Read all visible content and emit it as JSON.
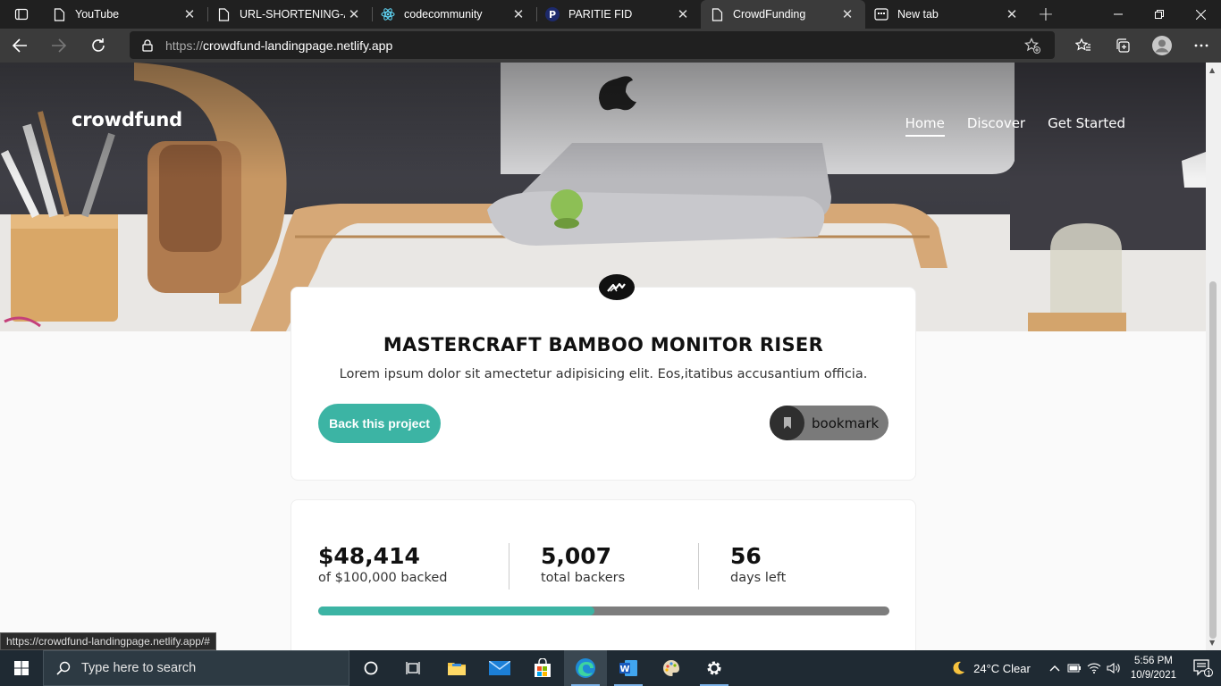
{
  "browser": {
    "tabs": [
      {
        "title": "YouTube",
        "icon": "page-icon",
        "active": false
      },
      {
        "title": "URL-SHORTENING-API",
        "icon": "page-icon",
        "active": false
      },
      {
        "title": "codecommunity",
        "icon": "react-icon",
        "active": false
      },
      {
        "title": "PARITIE FID",
        "icon": "p-logo-icon",
        "active": false
      },
      {
        "title": "CrowdFunding",
        "icon": "page-icon",
        "active": true
      },
      {
        "title": "New tab",
        "icon": "newtab-icon",
        "active": false
      }
    ],
    "close_glyph": "✕",
    "new_tab_glyph": "+",
    "url_scheme": "https://",
    "url_host": "crowdfund-landingpage.netlify.app",
    "status_url": "https://crowdfund-landingpage.netlify.app/#"
  },
  "site": {
    "brand": "crowdfund",
    "nav": [
      "Home",
      "Discover",
      "Get Started"
    ],
    "active_nav": "Home"
  },
  "project": {
    "title": "MASTERCRAFT BAMBOO MONITOR RISER",
    "description": "Lorem ipsum dolor sit amectetur adipisicing elit. Eos,itatibus accusantium officia.",
    "back_label": "Back this project",
    "bookmark_label": "bookmark"
  },
  "stats": {
    "backed_amount": "$48,414",
    "backed_caption": "of $100,000 backed",
    "backers": "5,007",
    "backers_caption": "total backers",
    "days": "56",
    "days_caption": "days left",
    "progress_fraction": 0.484
  },
  "taskbar": {
    "search_placeholder": "Type here to search",
    "weather": "24°C  Clear",
    "time": "5:56 PM",
    "date": "10/9/2021",
    "notification_count": "1"
  },
  "colors": {
    "accent": "#3cb4a4",
    "progress_track": "#7d7d7d"
  }
}
